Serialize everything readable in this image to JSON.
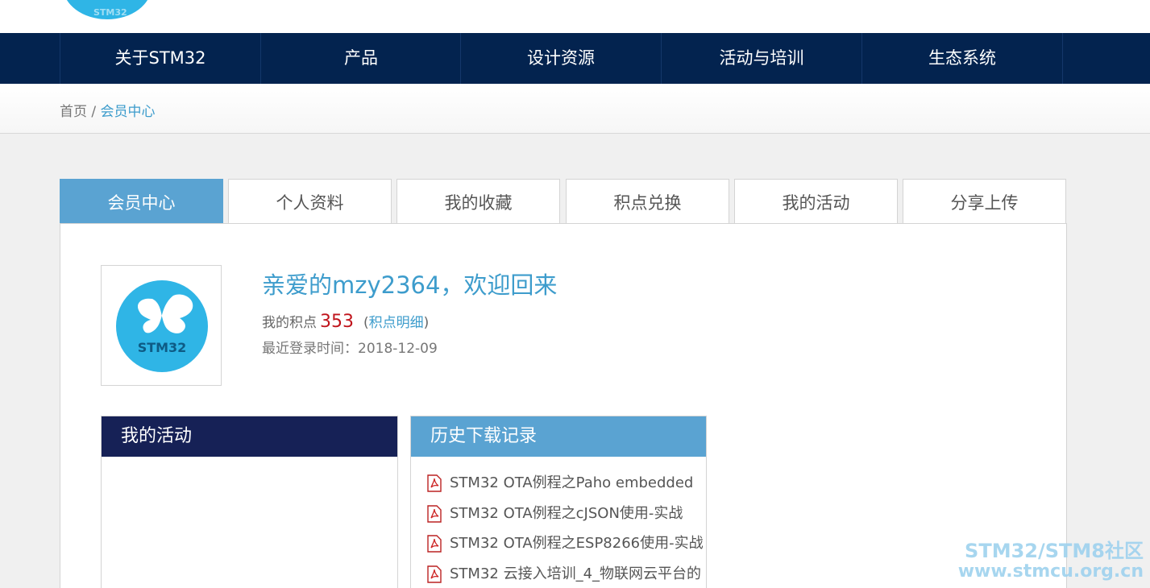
{
  "logo": {
    "text": "STM32"
  },
  "nav": {
    "items": [
      "关于STM32",
      "产品",
      "设计资源",
      "活动与培训",
      "生态系统"
    ]
  },
  "breadcrumb": {
    "home": "首页",
    "separator": "/",
    "current": "会员中心"
  },
  "tabs": [
    "会员中心",
    "个人资料",
    "我的收藏",
    "积点兑换",
    "我的活动",
    "分享上传"
  ],
  "profile": {
    "avatar_text": "STM32",
    "welcome": "亲爱的mzy2364，欢迎回来",
    "points_label": "我的积点",
    "points_value": "353",
    "points_link": "积点明细",
    "last_login_label": "最近登录时间：",
    "last_login_value": "2018-12-09"
  },
  "activity_box": {
    "title": "我的活动"
  },
  "download_box": {
    "title": "历史下载记录",
    "items": [
      "STM32 OTA例程之Paho embedded",
      "STM32 OTA例程之cJSON使用-实战",
      "STM32 OTA例程之ESP8266使用-实战",
      "STM32 云接入培训_4_物联网云平台的"
    ]
  },
  "watermark": {
    "line1": "STM32/STM8社区",
    "line2": "www.stmcu.org.cn"
  },
  "colors": {
    "nav_bg": "#03234f",
    "accent_blue": "#5aa3d2",
    "link_blue": "#3d9ccc",
    "dark_navy": "#162156",
    "points_red": "#c0141c",
    "logo_blue": "#2fb5e6"
  }
}
